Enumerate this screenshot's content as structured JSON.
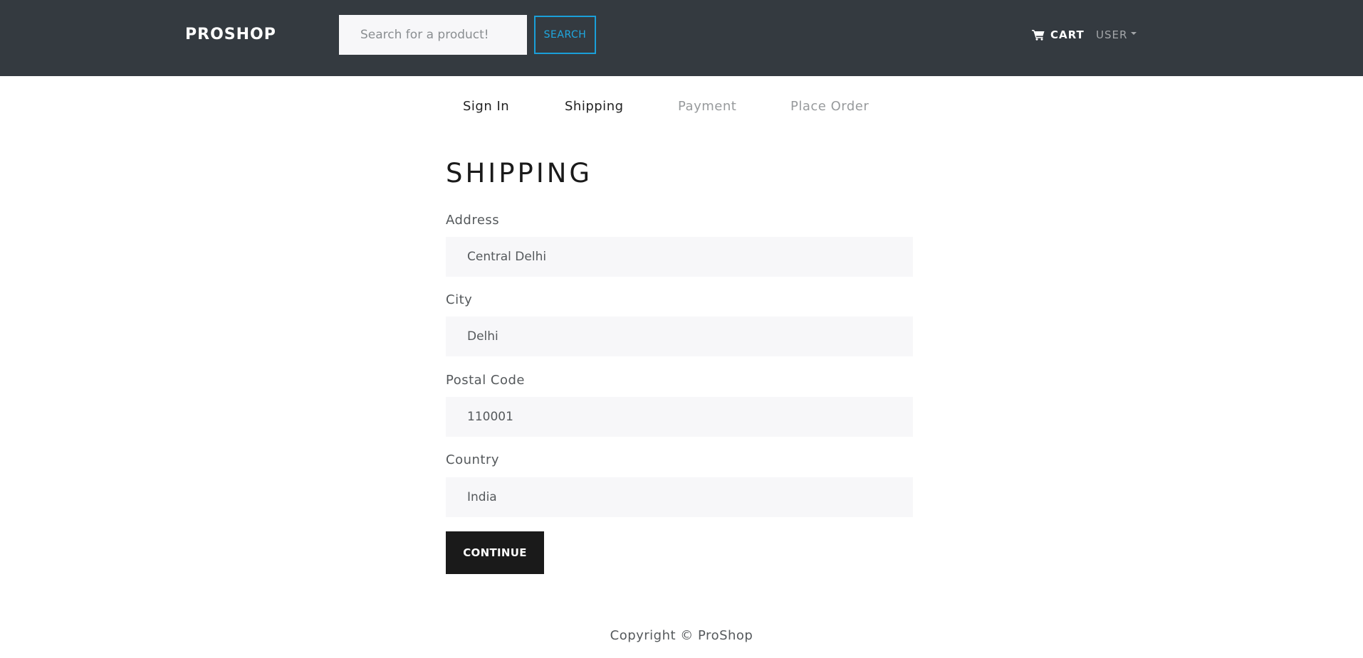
{
  "header": {
    "brand": "PROSHOP",
    "search": {
      "placeholder": "Search for a product!",
      "value": "",
      "button_label": "SEARCH"
    },
    "cart": {
      "label": "CART",
      "icon": "cart-icon"
    },
    "user_menu": {
      "label": "USER",
      "icon": "caret-down-icon"
    }
  },
  "steps": [
    {
      "label": "Sign In",
      "state": "enabled"
    },
    {
      "label": "Shipping",
      "state": "enabled"
    },
    {
      "label": "Payment",
      "state": "disabled"
    },
    {
      "label": "Place Order",
      "state": "disabled"
    }
  ],
  "form": {
    "title": "SHIPPING",
    "fields": {
      "address": {
        "label": "Address",
        "value": "Central Delhi"
      },
      "city": {
        "label": "City",
        "value": "Delhi"
      },
      "postal_code": {
        "label": "Postal Code",
        "value": "110001"
      },
      "country": {
        "label": "Country",
        "value": "India"
      }
    },
    "submit_label": "CONTINUE"
  },
  "footer": {
    "text": "Copyright © ProShop"
  },
  "colors": {
    "navbar": "#343a40",
    "accent": "#1a9fd9",
    "input_bg": "#f7f7f9",
    "primary_button": "#1a1a1a"
  }
}
